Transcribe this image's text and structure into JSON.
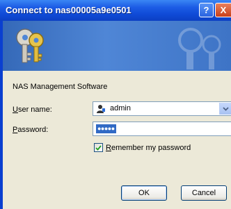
{
  "window": {
    "title": "Connect to nas00005a9e0501",
    "help_label": "?",
    "close_label": "X"
  },
  "dialog": {
    "app_name": "NAS Management Software",
    "user_label_first": "U",
    "user_label_rest": "ser name:",
    "password_label_first": "P",
    "password_label_rest": "assword:",
    "username_value": "admin",
    "password_mask": "●●●●●",
    "remember_first": "R",
    "remember_rest": "emember my password",
    "remember_checked": true,
    "ok_label": "OK",
    "cancel_label": "Cancel"
  },
  "colors": {
    "titlebar": "#0f4ad6",
    "banner": "#4f86d6",
    "client": "#ece9d8"
  },
  "icons": {
    "banner": "keys-icon",
    "user": "user-icon",
    "dropdown": "chevron-down-icon",
    "check": "checkmark-icon"
  }
}
